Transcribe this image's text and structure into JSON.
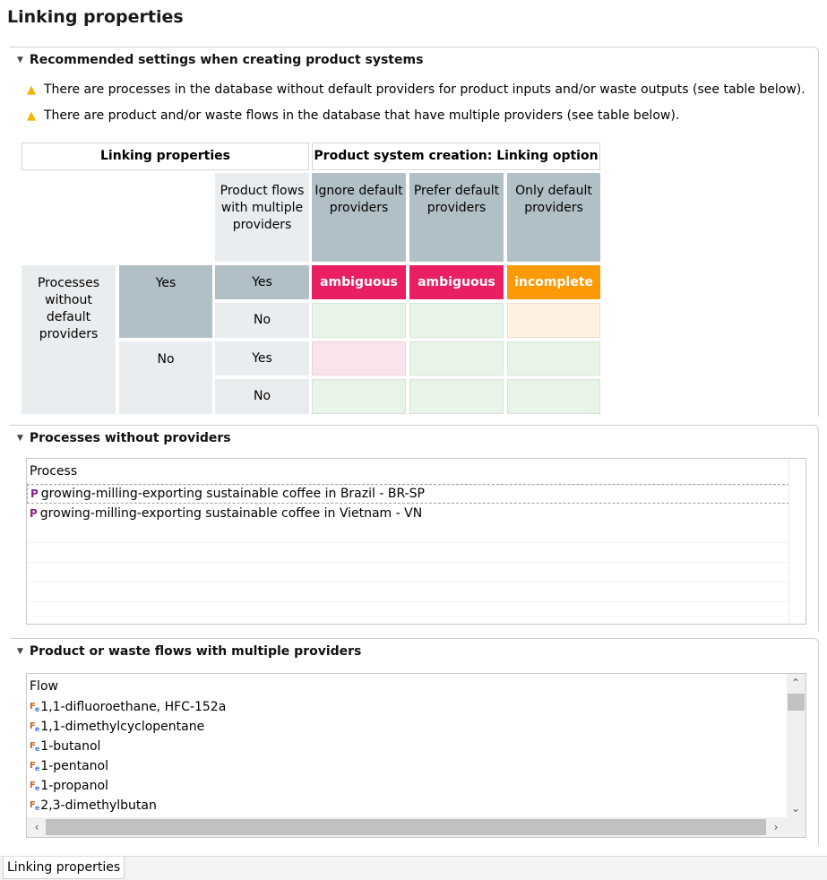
{
  "title": "Linking properties",
  "recommended": {
    "header": "Recommended settings when creating product systems",
    "warnings": [
      "There are processes in the database without default providers for product inputs and/or waste outputs (see table below).",
      "There are product and/or waste flows in the database that have multiple providers (see table below)."
    ],
    "table": {
      "left_header": "Linking properties",
      "right_header": "Product system creation: Linking option",
      "col_multi": "Product flows with multiple providers",
      "opt_ignore": "Ignore default providers",
      "opt_prefer": "Prefer default providers",
      "opt_only": "Only default providers",
      "row_label": "Processes without default providers",
      "yes": "Yes",
      "no": "No",
      "ambiguous": "ambiguous",
      "incomplete": "incomplete"
    }
  },
  "processes": {
    "header": "Processes without providers",
    "column": "Process",
    "items": [
      "growing-milling-exporting sustainable coffee in Brazil - BR-SP",
      "growing-milling-exporting sustainable coffee in Vietnam - VN"
    ]
  },
  "flows": {
    "header": "Product or waste flows with multiple providers",
    "column": "Flow",
    "items": [
      "1,1-difluoroethane, HFC-152a",
      "1,1-dimethylcyclopentane",
      "1-butanol",
      "1-pentanol",
      "1-propanol",
      "2,3-dimethylbutan"
    ]
  },
  "footer_tab": "Linking properties",
  "icons": {
    "warning": "warning-icon",
    "process": "process-icon",
    "flow": "flow-icon"
  },
  "colors": {
    "ambiguous": "#e91e63",
    "incomplete": "#fb9a05",
    "ok": "#e7f4e7"
  }
}
